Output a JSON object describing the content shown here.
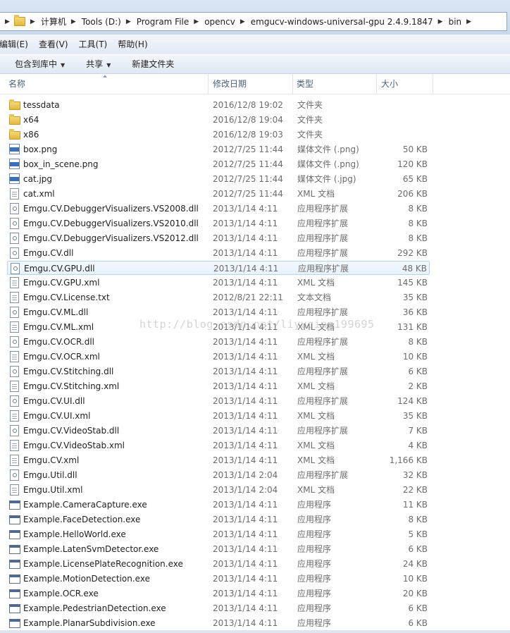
{
  "address": {
    "crumbs": [
      "计算机",
      "Tools (D:)",
      "Program File",
      "opencv",
      "emgucv-windows-universal-gpu 2.4.9.1847",
      "bin"
    ]
  },
  "menu": {
    "items": [
      "编辑(E)",
      "查看(V)",
      "工具(T)",
      "帮助(H)"
    ]
  },
  "toolbar": {
    "include_library": "包含到库中",
    "share": "共享",
    "new_folder": "新建文件夹"
  },
  "columns": {
    "name": "名称",
    "date": "修改日期",
    "type": "类型",
    "size": "大小"
  },
  "watermark": "http://blog.csdn.net/liyuqian199695",
  "files": [
    {
      "name": "tessdata",
      "date": "2016/12/8 19:02",
      "type": "文件夹",
      "size": "",
      "icon": "folder-icon"
    },
    {
      "name": "x64",
      "date": "2016/12/8 19:04",
      "type": "文件夹",
      "size": "",
      "icon": "folder-icon"
    },
    {
      "name": "x86",
      "date": "2016/12/8 19:03",
      "type": "文件夹",
      "size": "",
      "icon": "folder-icon"
    },
    {
      "name": "box.png",
      "date": "2012/7/25 11:44",
      "type": "媒体文件 (.png)",
      "size": "50 KB",
      "icon": "png-icon"
    },
    {
      "name": "box_in_scene.png",
      "date": "2012/7/25 11:44",
      "type": "媒体文件 (.png)",
      "size": "120 KB",
      "icon": "png-icon"
    },
    {
      "name": "cat.jpg",
      "date": "2012/7/25 11:44",
      "type": "媒体文件 (.jpg)",
      "size": "65 KB",
      "icon": "jpg-icon"
    },
    {
      "name": "cat.xml",
      "date": "2012/7/25 11:44",
      "type": "XML 文档",
      "size": "206 KB",
      "icon": "xml-icon"
    },
    {
      "name": "Emgu.CV.DebuggerVisualizers.VS2008.dll",
      "date": "2013/1/14 4:11",
      "type": "应用程序扩展",
      "size": "8 KB",
      "icon": "dll-icon"
    },
    {
      "name": "Emgu.CV.DebuggerVisualizers.VS2010.dll",
      "date": "2013/1/14 4:11",
      "type": "应用程序扩展",
      "size": "8 KB",
      "icon": "dll-icon"
    },
    {
      "name": "Emgu.CV.DebuggerVisualizers.VS2012.dll",
      "date": "2013/1/14 4:11",
      "type": "应用程序扩展",
      "size": "8 KB",
      "icon": "dll-icon"
    },
    {
      "name": "Emgu.CV.dll",
      "date": "2013/1/14 4:11",
      "type": "应用程序扩展",
      "size": "292 KB",
      "icon": "dll-icon"
    },
    {
      "name": "Emgu.CV.GPU.dll",
      "date": "2013/1/14 4:11",
      "type": "应用程序扩展",
      "size": "48 KB",
      "icon": "dll-icon",
      "selected": true
    },
    {
      "name": "Emgu.CV.GPU.xml",
      "date": "2013/1/14 4:11",
      "type": "XML 文档",
      "size": "145 KB",
      "icon": "xml-icon"
    },
    {
      "name": "Emgu.CV.License.txt",
      "date": "2012/8/21 22:11",
      "type": "文本文档",
      "size": "35 KB",
      "icon": "txt-icon"
    },
    {
      "name": "Emgu.CV.ML.dll",
      "date": "2013/1/14 4:11",
      "type": "应用程序扩展",
      "size": "36 KB",
      "icon": "dll-icon"
    },
    {
      "name": "Emgu.CV.ML.xml",
      "date": "2013/1/14 4:11",
      "type": "XML 文档",
      "size": "131 KB",
      "icon": "xml-icon"
    },
    {
      "name": "Emgu.CV.OCR.dll",
      "date": "2013/1/14 4:11",
      "type": "应用程序扩展",
      "size": "8 KB",
      "icon": "dll-icon"
    },
    {
      "name": "Emgu.CV.OCR.xml",
      "date": "2013/1/14 4:11",
      "type": "XML 文档",
      "size": "10 KB",
      "icon": "xml-icon"
    },
    {
      "name": "Emgu.CV.Stitching.dll",
      "date": "2013/1/14 4:11",
      "type": "应用程序扩展",
      "size": "6 KB",
      "icon": "dll-icon"
    },
    {
      "name": "Emgu.CV.Stitching.xml",
      "date": "2013/1/14 4:11",
      "type": "XML 文档",
      "size": "2 KB",
      "icon": "xml-icon"
    },
    {
      "name": "Emgu.CV.UI.dll",
      "date": "2013/1/14 4:11",
      "type": "应用程序扩展",
      "size": "124 KB",
      "icon": "dll-icon"
    },
    {
      "name": "Emgu.CV.UI.xml",
      "date": "2013/1/14 4:11",
      "type": "XML 文档",
      "size": "35 KB",
      "icon": "xml-icon"
    },
    {
      "name": "Emgu.CV.VideoStab.dll",
      "date": "2013/1/14 4:11",
      "type": "应用程序扩展",
      "size": "7 KB",
      "icon": "dll-icon"
    },
    {
      "name": "Emgu.CV.VideoStab.xml",
      "date": "2013/1/14 4:11",
      "type": "XML 文档",
      "size": "4 KB",
      "icon": "xml-icon"
    },
    {
      "name": "Emgu.CV.xml",
      "date": "2013/1/14 4:11",
      "type": "XML 文档",
      "size": "1,166 KB",
      "icon": "xml-icon"
    },
    {
      "name": "Emgu.Util.dll",
      "date": "2013/1/14 2:04",
      "type": "应用程序扩展",
      "size": "32 KB",
      "icon": "dll-icon"
    },
    {
      "name": "Emgu.Util.xml",
      "date": "2013/1/14 2:04",
      "type": "XML 文档",
      "size": "22 KB",
      "icon": "xml-icon"
    },
    {
      "name": "Example.CameraCapture.exe",
      "date": "2013/1/14 4:11",
      "type": "应用程序",
      "size": "11 KB",
      "icon": "exe-icon"
    },
    {
      "name": "Example.FaceDetection.exe",
      "date": "2013/1/14 4:11",
      "type": "应用程序",
      "size": "8 KB",
      "icon": "exe-icon"
    },
    {
      "name": "Example.HelloWorld.exe",
      "date": "2013/1/14 4:11",
      "type": "应用程序",
      "size": "5 KB",
      "icon": "exe-icon"
    },
    {
      "name": "Example.LatenSvmDetector.exe",
      "date": "2013/1/14 4:11",
      "type": "应用程序",
      "size": "6 KB",
      "icon": "exe-icon"
    },
    {
      "name": "Example.LicensePlateRecognition.exe",
      "date": "2013/1/14 4:11",
      "type": "应用程序",
      "size": "24 KB",
      "icon": "exe-icon"
    },
    {
      "name": "Example.MotionDetection.exe",
      "date": "2013/1/14 4:11",
      "type": "应用程序",
      "size": "10 KB",
      "icon": "exe-icon"
    },
    {
      "name": "Example.OCR.exe",
      "date": "2013/1/14 4:11",
      "type": "应用程序",
      "size": "20 KB",
      "icon": "exe-icon"
    },
    {
      "name": "Example.PedestrianDetection.exe",
      "date": "2013/1/14 4:11",
      "type": "应用程序",
      "size": "6 KB",
      "icon": "exe-icon"
    },
    {
      "name": "Example.PlanarSubdivision.exe",
      "date": "2013/1/14 4:11",
      "type": "应用程序",
      "size": "6 KB",
      "icon": "exe-icon"
    }
  ]
}
